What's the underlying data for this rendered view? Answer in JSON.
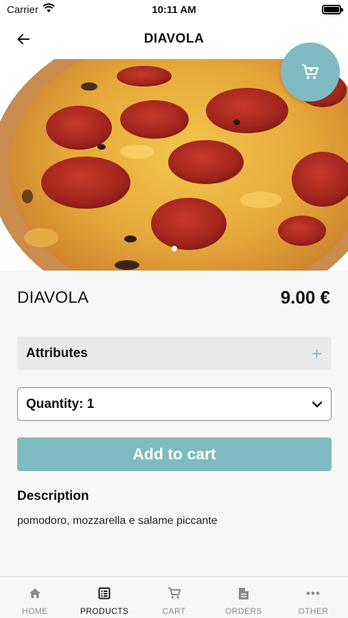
{
  "status_bar": {
    "carrier": "Carrier",
    "time": "10:11 AM"
  },
  "nav": {
    "title": "DIAVOLA"
  },
  "product": {
    "name": "DIAVOLA",
    "price": "9.00 €",
    "image_icon": "pizza-photo"
  },
  "attributes": {
    "label": "Attributes",
    "icon": "plus-icon"
  },
  "quantity": {
    "label": "Quantity: 1",
    "icon": "chevron-down-icon"
  },
  "add_to_cart": {
    "label": "Add to cart"
  },
  "description": {
    "title": "Description",
    "text": "pomodoro, mozzarella e salame piccante"
  },
  "tabs": [
    {
      "label": "HOME",
      "icon": "home-icon",
      "active": false
    },
    {
      "label": "PRODUCTS",
      "icon": "list-icon",
      "active": true
    },
    {
      "label": "CART",
      "icon": "cart-icon",
      "active": false
    },
    {
      "label": "ORDERS",
      "icon": "document-icon",
      "active": false
    },
    {
      "label": "OTHER",
      "icon": "more-icon",
      "active": false
    }
  ],
  "colors": {
    "accent": "#7fbac0",
    "background": "#f7f7f7",
    "field": "#e9e9e9"
  }
}
